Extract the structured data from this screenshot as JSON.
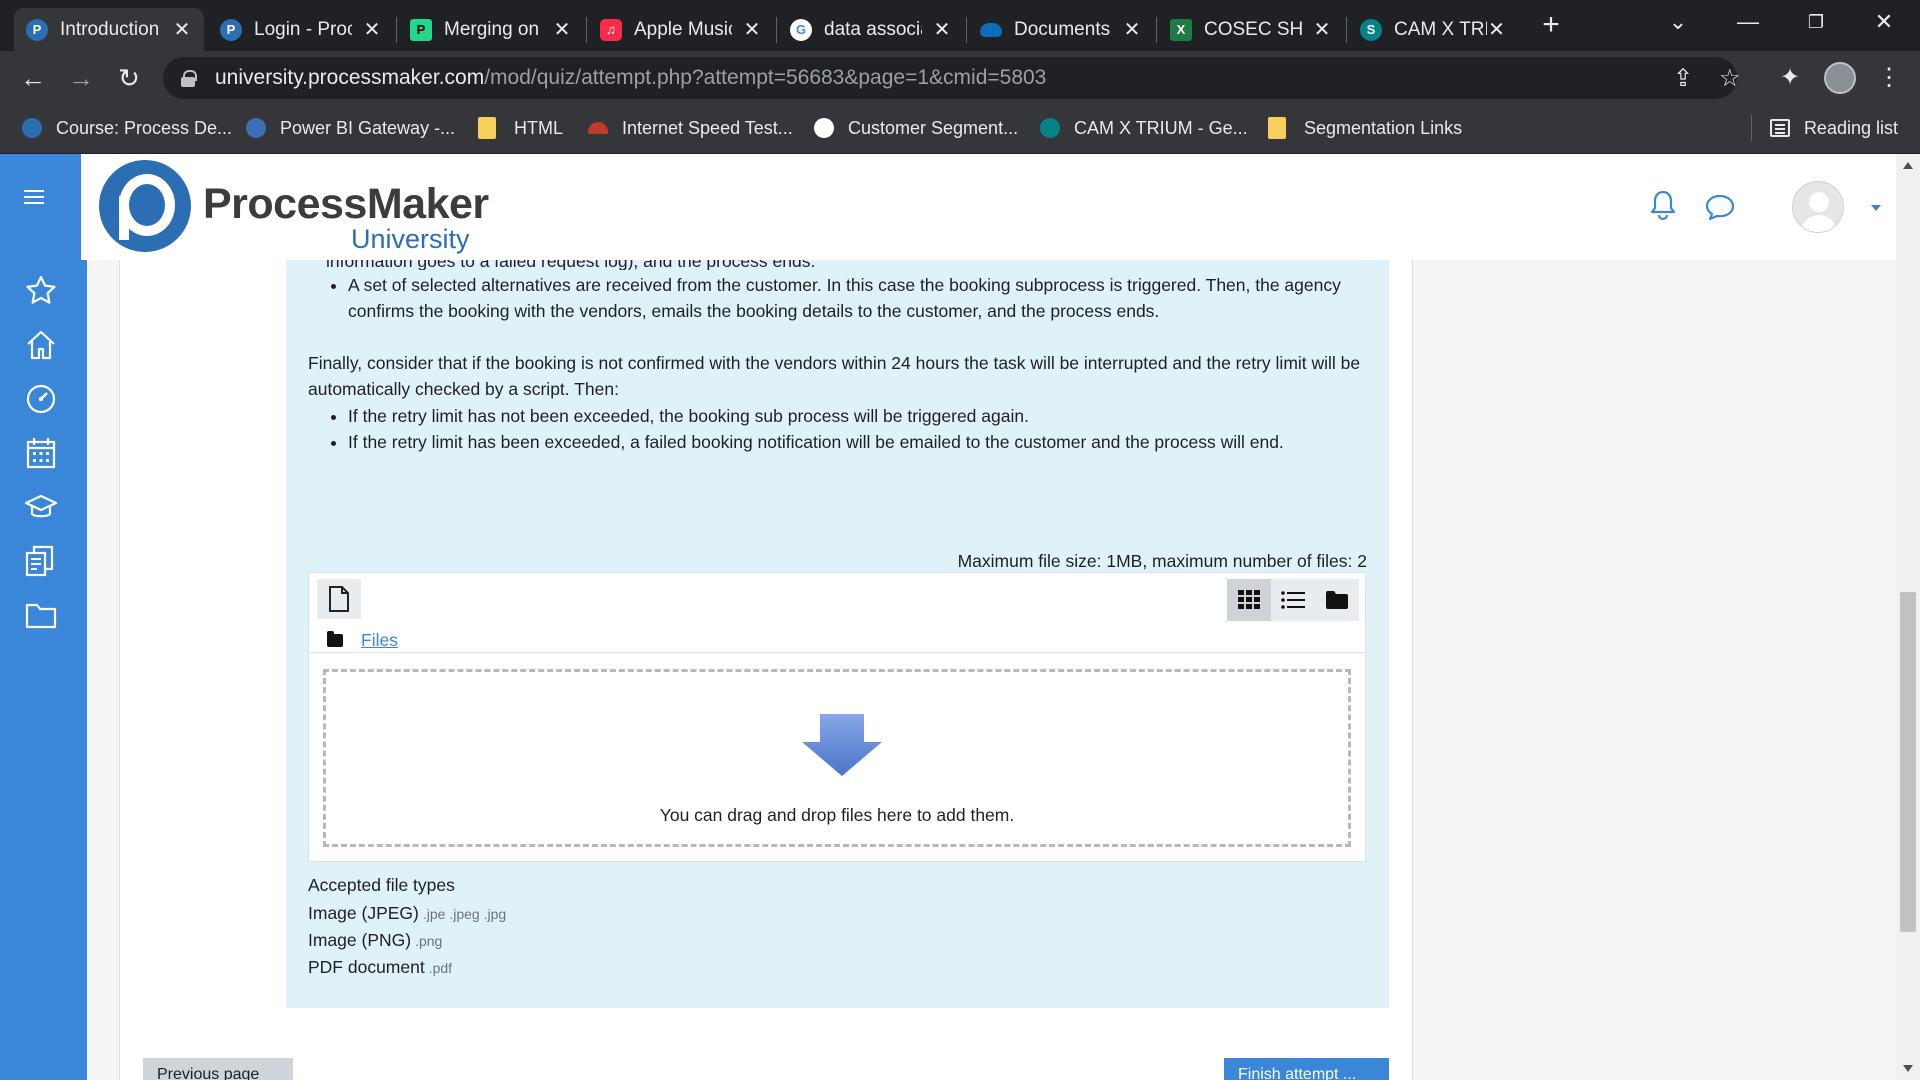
{
  "browser": {
    "tabs": [
      {
        "title": "Introduction",
        "favicon": "processmaker-icon",
        "color": "#2c6eb4",
        "active": true
      },
      {
        "title": "Login - ProcessMaker",
        "favicon": "processmaker-icon",
        "color": "#2c6eb4",
        "active": false
      },
      {
        "title": "Merging on",
        "favicon": "pycharm-icon",
        "color": "#21d789",
        "active": false
      },
      {
        "title": "Apple Music",
        "favicon": "apple-music-icon",
        "color": "#fa2d48",
        "active": false
      },
      {
        "title": "data association",
        "favicon": "google-icon",
        "color": "#ffffff",
        "active": false
      },
      {
        "title": "Documents",
        "favicon": "onedrive-icon",
        "color": "#0f6cbd",
        "active": false
      },
      {
        "title": "COSEC SHARE",
        "favicon": "excel-icon",
        "color": "#1f7a45",
        "active": false
      },
      {
        "title": "CAM X TRIUM",
        "favicon": "sharepoint-icon",
        "color": "#038387",
        "active": false
      }
    ],
    "url_host": "university.processmaker.com",
    "url_path": "/mod/quiz/attempt.php?attempt=56683&page=1&cmid=5803",
    "bookmarks": [
      {
        "label": "Course: Process De...",
        "icon": "processmaker-icon",
        "color": "#2c6eb4"
      },
      {
        "label": "Power BI Gateway -...",
        "icon": "powerbi-icon",
        "color": "#3d6eb5"
      },
      {
        "label": "HTML",
        "icon": "folder-icon",
        "color": "#f9cf5b"
      },
      {
        "label": "Internet Speed Test...",
        "icon": "speedtest-icon",
        "color": "#c0392b"
      },
      {
        "label": "Customer Segment...",
        "icon": "github-icon",
        "color": "#ffffff"
      },
      {
        "label": "CAM X TRIUM - Ge...",
        "icon": "sharepoint-icon",
        "color": "#038387"
      },
      {
        "label": "Segmentation Links",
        "icon": "folder-icon",
        "color": "#f9cf5b"
      }
    ],
    "reading_list": "Reading list"
  },
  "site": {
    "logo_name": "ProcessMaker",
    "logo_sub": "University",
    "accent": "#3a87d9"
  },
  "question": {
    "cut_off_line": "information goes to a failed request log), and the process ends.",
    "bullet_alt": "A set of selected alternatives are received from the customer. In this case the booking subprocess is triggered. Then, the agency confirms the booking with the vendors, emails the booking details to the customer, and the process ends.",
    "finally": "Finally, consider that if the booking is not confirmed with the vendors within 24 hours the task will be interrupted and the retry limit will be automatically checked by a script. Then:",
    "bullet_retry_1": "If the retry limit has not been exceeded, the booking sub process will be triggered again.",
    "bullet_retry_2": "If the retry limit has been exceeded, a failed booking notification will be emailed to the customer and the process will end."
  },
  "upload": {
    "limits": "Maximum file size: 1MB, maximum number of files: 2",
    "path_label": "Files",
    "drop_text": "You can drag and drop files here to add them.",
    "accepted_label": "Accepted file types",
    "types": [
      {
        "name": "Image (JPEG)",
        "ext": ".jpe .jpeg .jpg"
      },
      {
        "name": "Image (PNG)",
        "ext": ".png"
      },
      {
        "name": "PDF document",
        "ext": ".pdf"
      }
    ]
  },
  "nav": {
    "prev_label": "Previous page",
    "finish_label": "Finish attempt ..."
  }
}
